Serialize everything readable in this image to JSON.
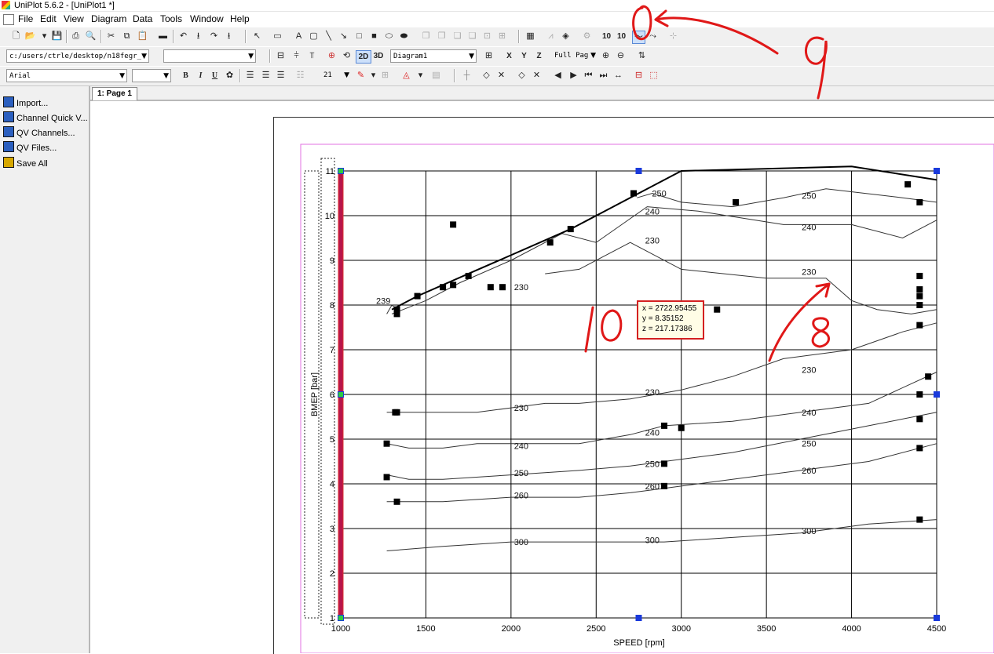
{
  "window": {
    "title": "UniPlot 5.6.2 - [UniPlot1 *]"
  },
  "menu": {
    "items": [
      "File",
      "Edit",
      "View",
      "Diagram",
      "Data",
      "Tools",
      "Window",
      "Help"
    ]
  },
  "toolbar": {
    "path_value": "c:/users/ctrle/desktop/n18fegr_",
    "diagram_value": "Diagram1",
    "view_2d": "2D",
    "view_3d": "3D",
    "axis_x": "X",
    "axis_y": "Y",
    "axis_z": "Z",
    "zoom_value": "Full Pag",
    "font_value": "Arial",
    "size_value": "21",
    "bold": "B",
    "italic": "I",
    "underline": "U",
    "num_a": "10",
    "num_b": "10"
  },
  "sidebar": {
    "items": [
      "Import...",
      "Channel Quick V...",
      "QV Channels...",
      "QV Files...",
      "Save All"
    ]
  },
  "tabs": [
    {
      "label": "1: Page 1"
    }
  ],
  "hint": {
    "line_x": "x = 2722.95455",
    "line_y": "y = 8.35152",
    "line_z": "z = 217.17386"
  },
  "annotations": {
    "mark_9_circle": "0",
    "mark_9": "9",
    "mark_8": "8",
    "mark_10": "10"
  },
  "chart_data": {
    "type": "contour",
    "xlabel": "SPEED [rpm]",
    "ylabel": "BMEP [bar]",
    "xlim": [
      1000,
      4500
    ],
    "ylim": [
      1,
      11
    ],
    "xticks": [
      1000,
      1500,
      2000,
      2500,
      3000,
      3500,
      4000,
      4500
    ],
    "yticks": [
      1,
      2,
      3,
      4,
      5,
      6,
      7,
      8,
      9,
      10,
      11
    ],
    "grid": true,
    "full_load_curve": {
      "x": [
        1300,
        1450,
        1750,
        2350,
        2750,
        3000,
        4000,
        4500
      ],
      "y": [
        7.9,
        8.2,
        8.7,
        9.7,
        10.5,
        11.0,
        11.1,
        10.8
      ]
    },
    "contours": [
      {
        "level": 239,
        "label": "239",
        "x": [
          1270,
          1300,
          1330
        ],
        "y": [
          7.8,
          8.0,
          7.9
        ]
      },
      {
        "level": 250,
        "label": "250",
        "x": [
          2740,
          2830,
          3000,
          3300,
          3600,
          3850,
          4300,
          4500
        ],
        "y": [
          10.4,
          10.5,
          10.3,
          10.2,
          10.4,
          10.6,
          10.4,
          10.3
        ]
      },
      {
        "level": 240,
        "label": "240",
        "x": [
          1300,
          1500,
          1700,
          2000,
          2300,
          2500,
          2800,
          3100,
          3600,
          4000,
          4300,
          4500
        ],
        "y": [
          7.8,
          8.1,
          8.5,
          9.0,
          9.6,
          9.4,
          10.2,
          10.1,
          9.8,
          9.8,
          9.5,
          9.9
        ]
      },
      {
        "level": 230,
        "label": "230",
        "x": [
          2200,
          2400,
          2700,
          3000,
          3500,
          3850,
          4000,
          4150,
          4350,
          4500
        ],
        "y": [
          8.7,
          8.8,
          9.4,
          8.8,
          8.6,
          8.6,
          8.1,
          7.9,
          7.8,
          7.9
        ]
      },
      {
        "level": 230,
        "label": "230",
        "x": [
          1270,
          1400,
          1600,
          1800,
          2000,
          2200,
          2400,
          2700,
          3000,
          3300,
          3600,
          4000,
          4300,
          4500
        ],
        "y": [
          5.6,
          5.6,
          5.6,
          5.6,
          5.7,
          5.8,
          5.8,
          5.9,
          6.1,
          6.4,
          6.8,
          7.0,
          7.4,
          7.6
        ]
      },
      {
        "level": 240,
        "label": "240",
        "x": [
          1270,
          1400,
          1600,
          1800,
          2000,
          2400,
          2700,
          2900,
          3300,
          3700,
          4100,
          4500
        ],
        "y": [
          4.9,
          4.8,
          4.8,
          4.9,
          4.9,
          4.9,
          5.1,
          5.3,
          5.4,
          5.6,
          5.8,
          6.5
        ]
      },
      {
        "level": 250,
        "label": "250",
        "x": [
          1270,
          1400,
          1600,
          2000,
          2400,
          2700,
          2900,
          3300,
          3700,
          4100,
          4500
        ],
        "y": [
          4.2,
          4.1,
          4.1,
          4.2,
          4.3,
          4.4,
          4.5,
          4.7,
          5.0,
          5.3,
          5.6
        ]
      },
      {
        "level": 260,
        "label": "260",
        "x": [
          1270,
          1600,
          2000,
          2400,
          2700,
          2900,
          3300,
          3700,
          4100,
          4500
        ],
        "y": [
          3.6,
          3.6,
          3.7,
          3.7,
          3.8,
          3.9,
          4.1,
          4.3,
          4.5,
          4.9
        ]
      },
      {
        "level": 300,
        "label": "300",
        "x": [
          1270,
          1600,
          2000,
          2400,
          2700,
          2900,
          3300,
          3700,
          4100,
          4500
        ],
        "y": [
          2.5,
          2.6,
          2.7,
          2.7,
          2.7,
          2.7,
          2.8,
          2.9,
          3.1,
          3.2
        ]
      }
    ],
    "contour_labels": [
      {
        "text": "239",
        "x": 1250,
        "y": 8.1
      },
      {
        "text": "250",
        "x": 2870,
        "y": 10.5
      },
      {
        "text": "240",
        "x": 2830,
        "y": 10.1
      },
      {
        "text": "230",
        "x": 2830,
        "y": 9.45
      },
      {
        "text": "250",
        "x": 3750,
        "y": 10.45
      },
      {
        "text": "240",
        "x": 3750,
        "y": 9.75
      },
      {
        "text": "230",
        "x": 3750,
        "y": 8.75
      },
      {
        "text": "230",
        "x": 2060,
        "y": 8.4
      },
      {
        "text": "230",
        "x": 3750,
        "y": 6.55
      },
      {
        "text": "230",
        "x": 2060,
        "y": 5.7
      },
      {
        "text": "230",
        "x": 2830,
        "y": 6.05
      },
      {
        "text": "240",
        "x": 3750,
        "y": 5.6
      },
      {
        "text": "240",
        "x": 2830,
        "y": 5.15
      },
      {
        "text": "240",
        "x": 2060,
        "y": 4.85
      },
      {
        "text": "250",
        "x": 3750,
        "y": 4.9
      },
      {
        "text": "250",
        "x": 2830,
        "y": 4.45
      },
      {
        "text": "250",
        "x": 2060,
        "y": 4.25
      },
      {
        "text": "260",
        "x": 3750,
        "y": 4.3
      },
      {
        "text": "260",
        "x": 2830,
        "y": 3.95
      },
      {
        "text": "260",
        "x": 2060,
        "y": 3.75
      },
      {
        "text": "300",
        "x": 3750,
        "y": 2.95
      },
      {
        "text": "300",
        "x": 2830,
        "y": 2.75
      },
      {
        "text": "300",
        "x": 2060,
        "y": 2.7
      }
    ],
    "markers": {
      "x": [
        1330,
        1330,
        1450,
        1600,
        1660,
        1750,
        1880,
        1950,
        1320,
        2230,
        2350,
        2720,
        3320,
        4330,
        4400,
        4400,
        4400,
        4400,
        4400,
        4400,
        4400,
        4450,
        1270,
        1270,
        1330,
        1330,
        2900,
        2900,
        2900,
        3000,
        4400,
        4400,
        4400,
        3210,
        1660
      ],
      "y": [
        7.8,
        7.9,
        8.2,
        8.4,
        8.45,
        8.65,
        8.4,
        8.4,
        5.6,
        9.4,
        9.7,
        10.5,
        10.3,
        10.7,
        10.3,
        8.65,
        8.35,
        8.2,
        8.0,
        7.55,
        6.0,
        6.4,
        4.9,
        4.15,
        5.6,
        3.6,
        5.3,
        4.45,
        3.95,
        5.25,
        5.45,
        4.8,
        3.2,
        7.9,
        9.8
      ]
    }
  }
}
